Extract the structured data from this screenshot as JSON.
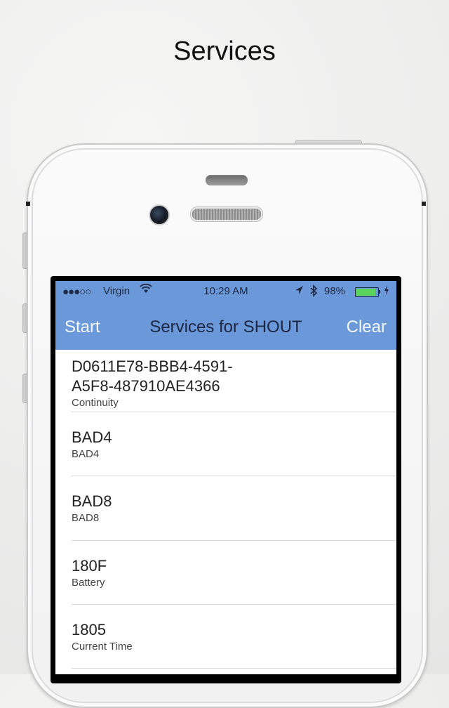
{
  "page": {
    "heading": "Services"
  },
  "status_bar": {
    "signal": "●●●○○",
    "carrier": "Virgin",
    "time": "10:29 AM",
    "battery_percent": "98%",
    "battery_level": 0.98,
    "battery_color": "#5ad45a"
  },
  "nav": {
    "left_button": "Start",
    "title": "Services for SHOUT",
    "right_button": "Clear",
    "background_color": "#6a98d9"
  },
  "services": [
    {
      "uuid_line1": "D0611E78-BBB4-4591-",
      "uuid_line2": "A5F8-487910AE4366",
      "name": "Continuity"
    },
    {
      "uuid": "BAD4",
      "name": "BAD4"
    },
    {
      "uuid": "BAD8",
      "name": "BAD8"
    },
    {
      "uuid": "180F",
      "name": "Battery"
    },
    {
      "uuid": "1805",
      "name": "Current Time"
    }
  ],
  "icons": [
    "wifi-icon",
    "location-arrow-icon",
    "bluetooth-icon",
    "battery-icon",
    "charging-bolt-icon",
    "front-camera-icon"
  ]
}
